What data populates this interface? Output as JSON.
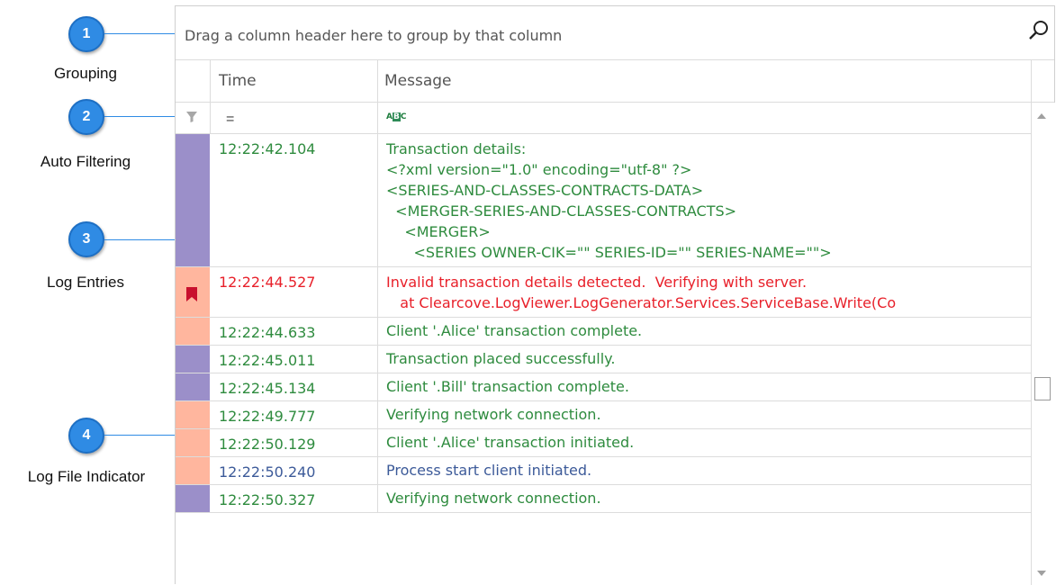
{
  "callouts": [
    {
      "number": "1",
      "label": "Grouping"
    },
    {
      "number": "2",
      "label": "Auto Filtering"
    },
    {
      "number": "3",
      "label": "Log Entries"
    },
    {
      "number": "4",
      "label": "Log File Indicator"
    }
  ],
  "grid": {
    "group_panel_text": "Drag a column header here to group by that column",
    "columns": {
      "time": "Time",
      "message": "Message"
    },
    "filter": {
      "time_operator": "=",
      "message_icon": "abc-filter-icon"
    },
    "colors": {
      "purple_indicator": "#9b8fc9",
      "salmon_indicator": "#ffb69e",
      "green_text": "#2e8b3e",
      "red_text": "#e8202a",
      "blue_text": "#3c5a99",
      "bookmark": "#c8102e"
    },
    "rows": [
      {
        "time": "12:22:42.104",
        "message": "Transaction details:\n<?xml version=\"1.0\" encoding=\"utf-8\" ?>\n<SERIES-AND-CLASSES-CONTRACTS-DATA>\n  <MERGER-SERIES-AND-CLASSES-CONTRACTS>\n    <MERGER>\n      <SERIES OWNER-CIK=\"\" SERIES-ID=\"\" SERIES-NAME=\"\">",
        "level": "green",
        "file": "purple",
        "bookmark": false
      },
      {
        "time": "12:22:44.527",
        "message": "Invalid transaction details detected.  Verifying with server.\n   at Clearcove.LogViewer.LogGenerator.Services.ServiceBase.Write(Co",
        "level": "red",
        "file": "salmon",
        "bookmark": true
      },
      {
        "time": "12:22:44.633",
        "message": "Client '.Alice' transaction complete.",
        "level": "green",
        "file": "salmon",
        "bookmark": false
      },
      {
        "time": "12:22:45.011",
        "message": "Transaction placed successfully.",
        "level": "green",
        "file": "purple",
        "bookmark": false
      },
      {
        "time": "12:22:45.134",
        "message": "Client '.Bill' transaction complete.",
        "level": "green",
        "file": "purple",
        "bookmark": false
      },
      {
        "time": "12:22:49.777",
        "message": "Verifying network connection.",
        "level": "green",
        "file": "salmon",
        "bookmark": false
      },
      {
        "time": "12:22:50.129",
        "message": "Client '.Alice' transaction initiated.",
        "level": "green",
        "file": "salmon",
        "bookmark": false
      },
      {
        "time": "12:22:50.240",
        "message": "Process start client initiated.",
        "level": "blue",
        "file": "salmon",
        "bookmark": false
      },
      {
        "time": "12:22:50.327",
        "message": "Verifying network connection.",
        "level": "green",
        "file": "purple",
        "bookmark": false
      }
    ]
  }
}
